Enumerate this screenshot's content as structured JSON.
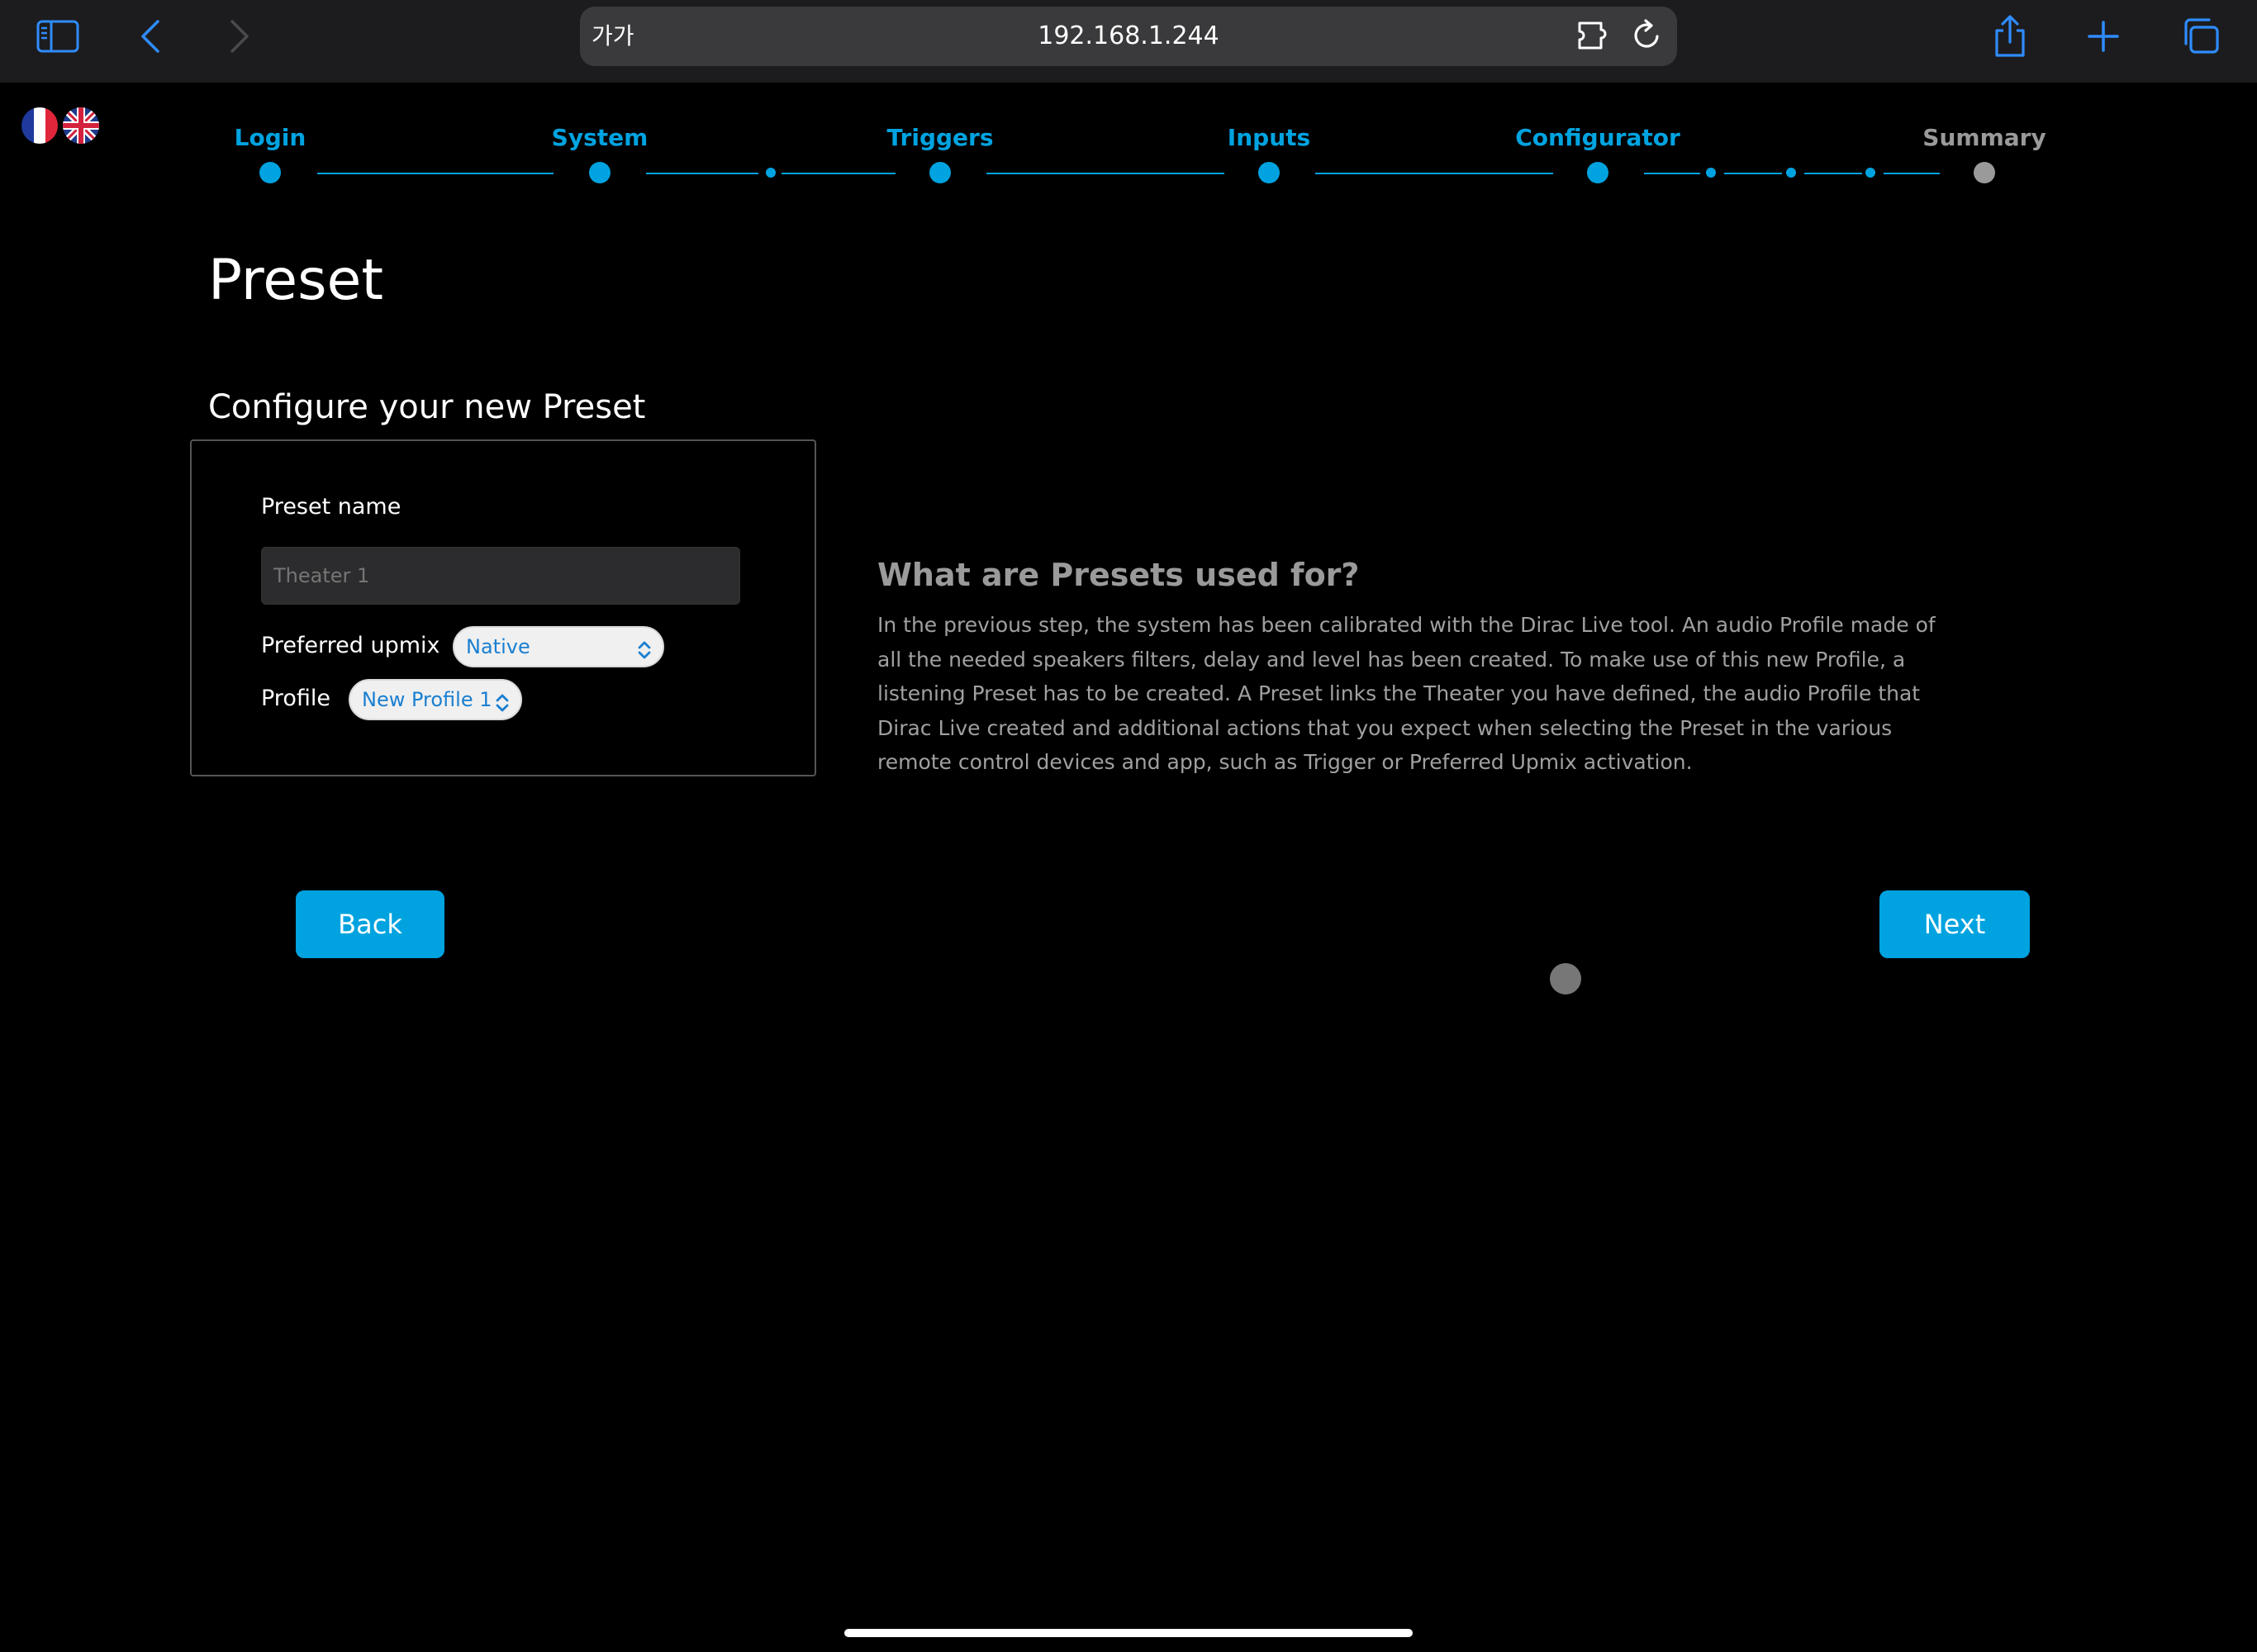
{
  "browser": {
    "reader_label": "가가",
    "url": "192.168.1.244"
  },
  "languages": [
    "French",
    "English"
  ],
  "stepper": {
    "steps": [
      {
        "label": "Login",
        "active": true
      },
      {
        "label": "System",
        "active": true
      },
      {
        "label": "Triggers",
        "active": true
      },
      {
        "label": "Inputs",
        "active": true
      },
      {
        "label": "Configurator",
        "active": true
      },
      {
        "label": "Summary",
        "active": false
      }
    ]
  },
  "page": {
    "title": "Preset",
    "section_title": "Configure your new Preset"
  },
  "form": {
    "preset_name_label": "Preset name",
    "preset_name_placeholder": "Theater 1",
    "upmix_label": "Preferred upmix",
    "upmix_value": "Native",
    "profile_label": "Profile",
    "profile_value": "New Profile 1"
  },
  "help": {
    "title": "What are Presets used for?",
    "text": "In the previous step, the system has been calibrated with the Dirac Live tool. An audio Profile made of all the needed speakers filters, delay and level has been created. To make use of this new Profile, a listening Preset has to be created. A Preset links the Theater you have defined, the audio Profile that Dirac Live created and additional actions that you expect when selecting the Preset in the various remote control devices and app, such as Trigger or Preferred Upmix activation."
  },
  "buttons": {
    "back": "Back",
    "next": "Next"
  },
  "colors": {
    "accent": "#00a3e0",
    "inactive": "#9a9a9a",
    "background": "#000000"
  }
}
